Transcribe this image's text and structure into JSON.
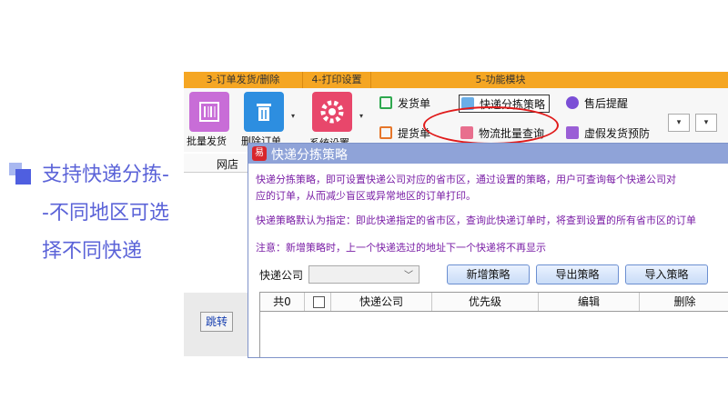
{
  "promo": {
    "text": "支持快递分拣--不同地区可选择不同快递"
  },
  "tabs": {
    "t3": "3-订单发货/删除",
    "t4": "4-打印设置",
    "t5": "5-功能模块"
  },
  "toolbar": {
    "batch_ship": "批量发货",
    "delete_order": "删除订单",
    "system_settings": "系统设置",
    "ship_single": "发货单",
    "express_sort": "快递分拣策略",
    "aftersale": "售后提醒",
    "pickup_single": "提货单",
    "logistics_query": "物流批量查询",
    "fake_ship_prevent": "虚假发货预防",
    "dropdown_arrow": "▾"
  },
  "left_panel": {
    "store_header": "网店",
    "jump_button": "跳转"
  },
  "dialog": {
    "title": "快递分拣策略",
    "logo_text": "易",
    "desc1_line1": "快递分拣策略，即可设置快递公司对应的省市区，通过设置的策略，用户可查询每个快递公司对",
    "desc1_line2": "应的订单，从而减少盲区或异常地区的订单打印。",
    "desc2": "快递策略默认为指定：即此快递指定的省市区，查询此快递订单时，将查到设置的所有省市区的订单",
    "note": "注意：新增策略时，上一个快递选过的地址下一个快递将不再显示",
    "company_label": "快递公司",
    "select_value": "",
    "btn_add": "新增策略",
    "btn_export": "导出策略",
    "btn_import": "导入策略",
    "table_headers": {
      "total": "共0",
      "company": "快递公司",
      "priority": "优先级",
      "edit": "编辑",
      "delete": "删除"
    }
  },
  "colors": {
    "accent_orange": "#f5a623",
    "highlight_red": "#e01b1b",
    "dialog_title_bg": "#8fa3d8",
    "desc_purple": "#7a1fa6",
    "promo_blue": "#5b63d8"
  }
}
